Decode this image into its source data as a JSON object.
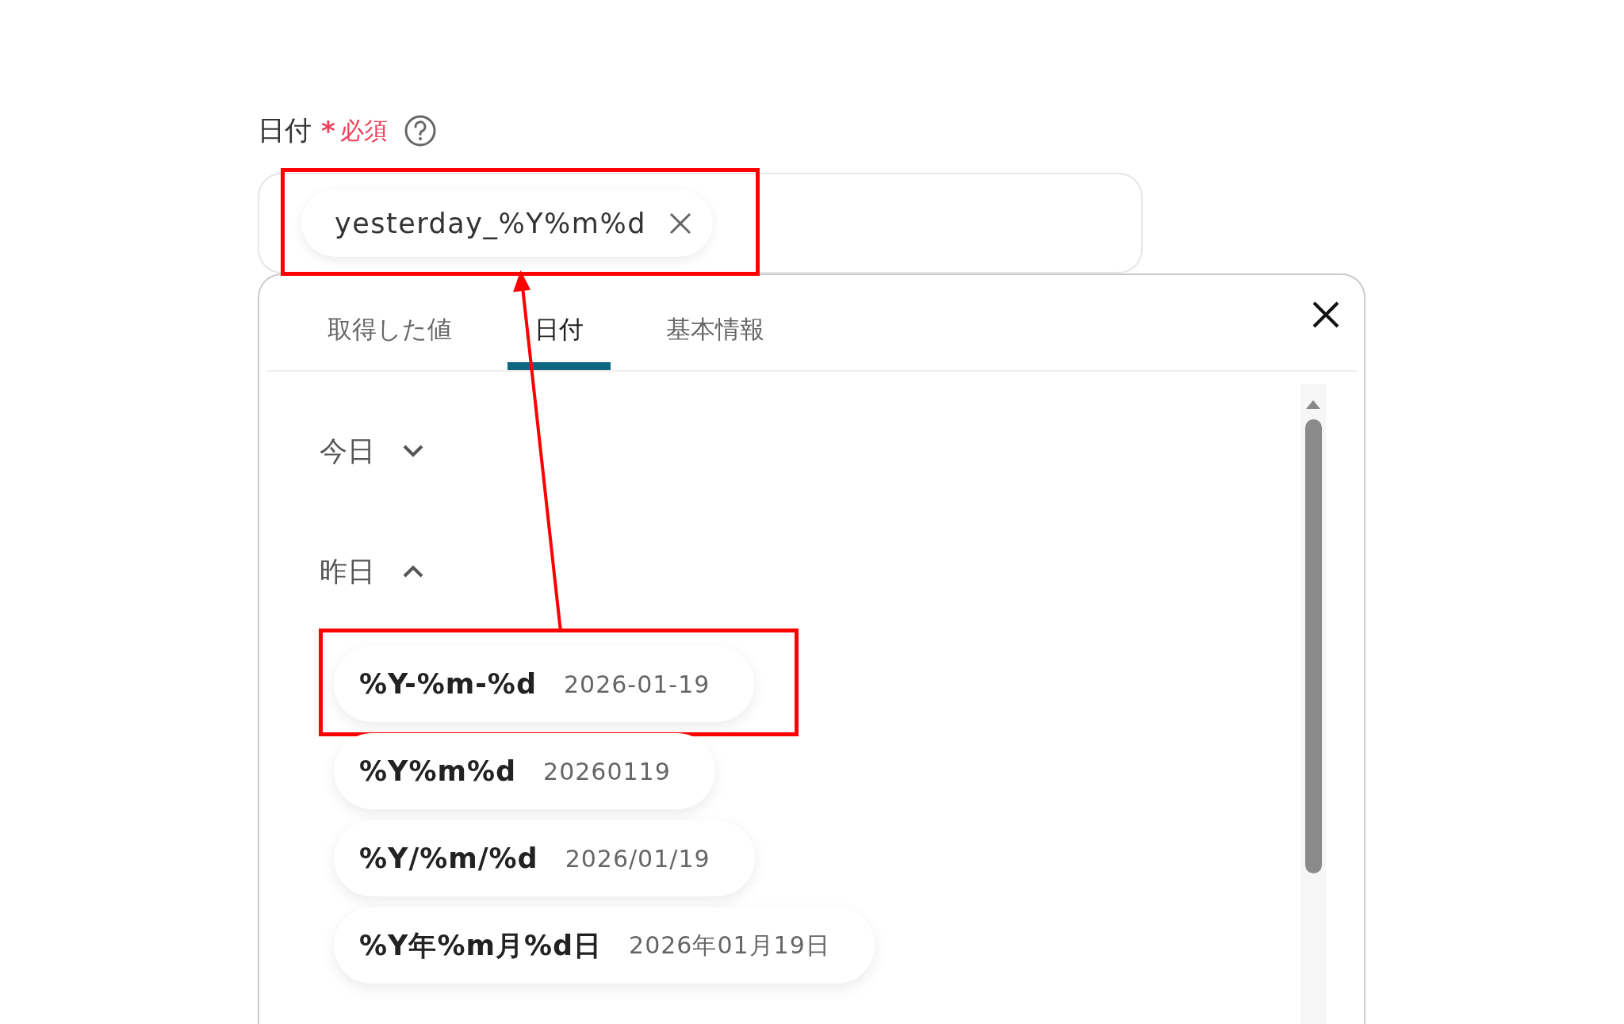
{
  "field": {
    "label": "日付",
    "required_mark": "*",
    "required_text": "必須",
    "chip": {
      "text": "yesterday_%Y%m%d",
      "highlighted": true
    }
  },
  "panel": {
    "tabs": [
      {
        "label": "取得した値",
        "selected": false
      },
      {
        "label": "日付",
        "selected": true
      },
      {
        "label": "基本情報",
        "selected": false
      }
    ],
    "sections": [
      {
        "title": "今日",
        "expanded": false
      },
      {
        "title": "昨日",
        "expanded": true,
        "options": [
          {
            "format": "%Y-%m-%d",
            "example": "2026-01-19",
            "highlighted": true
          },
          {
            "format": "%Y%m%d",
            "example": "20260119",
            "highlighted": false
          },
          {
            "format": "%Y/%m/%d",
            "example": "2026/01/19",
            "highlighted": false
          },
          {
            "format": "%Y年%m月%d日",
            "example": "2026年01月19日",
            "highlighted": false
          }
        ]
      }
    ]
  }
}
